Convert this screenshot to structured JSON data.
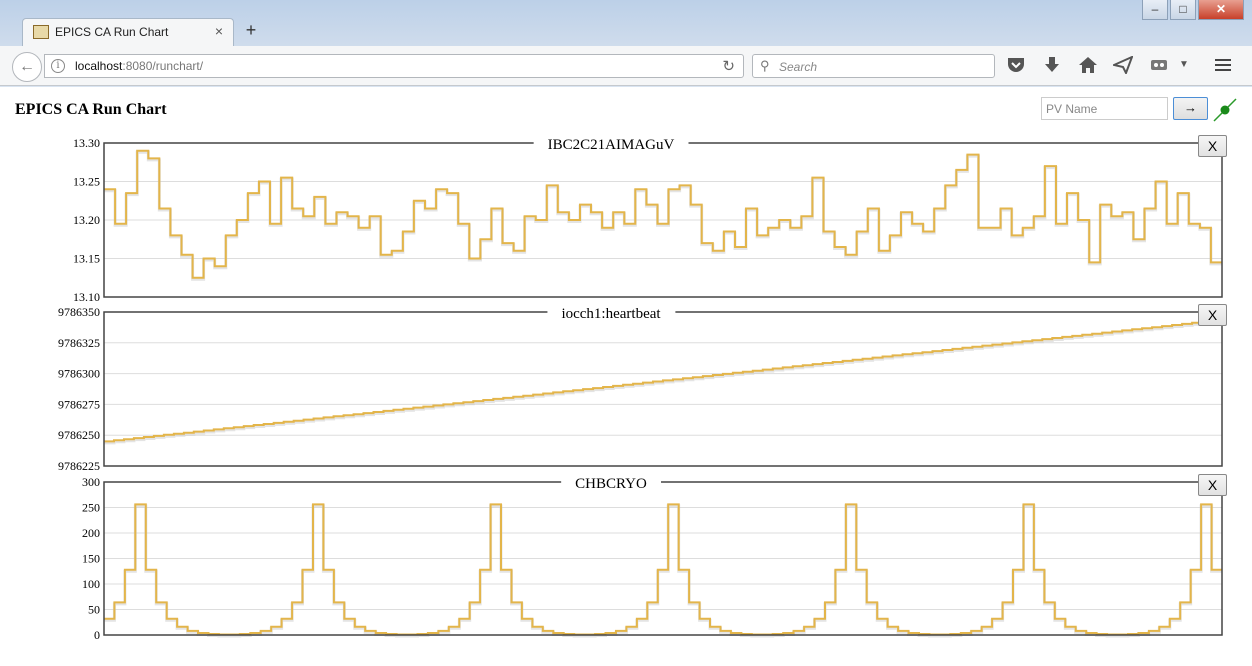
{
  "browser": {
    "tab_title": "EPICS CA Run Chart",
    "tab_close": "×",
    "new_tab": "+",
    "url_host": "localhost",
    "url_rest": ":8080/runchart/",
    "search_placeholder": "Search",
    "window_buttons": {
      "minimize": "–",
      "maximize": "□",
      "close": "✕"
    }
  },
  "page": {
    "title": "EPICS CA Run Chart",
    "pv_placeholder": "PV Name",
    "go_label": "→",
    "close_label": "X",
    "trace_color": "#e3b54a"
  },
  "chart_data": [
    {
      "type": "line",
      "step": true,
      "title": "IBC2C21AIMAGuV",
      "ylim": [
        13.1,
        13.3
      ],
      "yticks": [
        "13.30",
        "13.25",
        "13.20",
        "13.15",
        "13.10"
      ],
      "grid": true,
      "values": [
        13.24,
        13.195,
        13.235,
        13.29,
        13.28,
        13.215,
        13.18,
        13.155,
        13.125,
        13.15,
        13.14,
        13.18,
        13.2,
        13.235,
        13.25,
        13.195,
        13.255,
        13.215,
        13.205,
        13.23,
        13.195,
        13.21,
        13.205,
        13.19,
        13.205,
        13.155,
        13.16,
        13.185,
        13.225,
        13.215,
        13.24,
        13.235,
        13.195,
        13.15,
        13.175,
        13.215,
        13.17,
        13.16,
        13.205,
        13.2,
        13.245,
        13.21,
        13.2,
        13.22,
        13.21,
        13.19,
        13.21,
        13.195,
        13.24,
        13.22,
        13.195,
        13.24,
        13.245,
        13.22,
        13.17,
        13.16,
        13.185,
        13.165,
        13.215,
        13.18,
        13.19,
        13.2,
        13.19,
        13.205,
        13.255,
        13.185,
        13.165,
        13.155,
        13.185,
        13.215,
        13.16,
        13.18,
        13.21,
        13.195,
        13.185,
        13.215,
        13.245,
        13.265,
        13.285,
        13.19,
        13.19,
        13.215,
        13.18,
        13.19,
        13.205,
        13.27,
        13.195,
        13.235,
        13.2,
        13.145,
        13.22,
        13.205,
        13.21,
        13.175,
        13.215,
        13.25,
        13.195,
        13.235,
        13.195,
        13.19,
        13.145
      ]
    },
    {
      "type": "line",
      "step": true,
      "title": "iocch1:heartbeat",
      "ylim": [
        9786225,
        9786350
      ],
      "yticks": [
        "9786350",
        "9786325",
        "9786300",
        "9786275",
        "9786250",
        "9786225"
      ],
      "grid": true,
      "x_range": [
        0,
        100
      ],
      "y_range": [
        9786245,
        9786343
      ]
    },
    {
      "type": "line",
      "step": true,
      "title": "CHBCRYO",
      "ylim": [
        0,
        300
      ],
      "yticks": [
        "300",
        "250",
        "200",
        "150",
        "100",
        "50",
        "0"
      ],
      "grid": true,
      "values": [
        32,
        64,
        128,
        256,
        128,
        64,
        32,
        16,
        8,
        4,
        2,
        1,
        1,
        2,
        4,
        8,
        16,
        32,
        64,
        128,
        256,
        128,
        64,
        32,
        16,
        8,
        4,
        2,
        1,
        1,
        2,
        4,
        8,
        16,
        32,
        64,
        128,
        256,
        128,
        64,
        32,
        16,
        8,
        4,
        2,
        1,
        1,
        2,
        4,
        8,
        16,
        32,
        64,
        128,
        256,
        128,
        64,
        32,
        16,
        8,
        4,
        2,
        1,
        1,
        2,
        4,
        8,
        16,
        32,
        64,
        128,
        256,
        128,
        64,
        32,
        16,
        8,
        4,
        2,
        1,
        1,
        2,
        4,
        8,
        16,
        32,
        64,
        128,
        256,
        128,
        64,
        32,
        16,
        8,
        4,
        2,
        1,
        1,
        2,
        4,
        8,
        16,
        32,
        64,
        128,
        256,
        128
      ]
    }
  ]
}
